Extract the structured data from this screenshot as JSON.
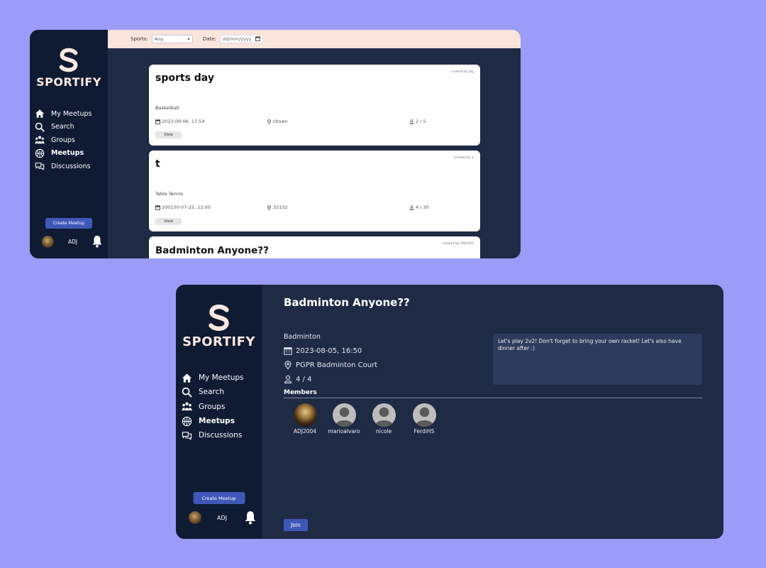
{
  "colors": {
    "background": "#9b9cf8",
    "sidebar": "#0e1b33",
    "main": "#1f2a45",
    "filter_bar": "#fbe4dc",
    "accent": "#3f58b8",
    "logo": "#fce8e1"
  },
  "app": {
    "name": "SPORTIFY"
  },
  "sidebar": {
    "items": [
      {
        "label": "My Meetups",
        "icon": "home-icon"
      },
      {
        "label": "Search",
        "icon": "search-icon"
      },
      {
        "label": "Groups",
        "icon": "groups-icon"
      },
      {
        "label": "Meetups",
        "icon": "meetups-icon",
        "active": true
      },
      {
        "label": "Discussions",
        "icon": "discussions-icon"
      }
    ],
    "create_button": "Create Meetup",
    "user_name": "ADJ"
  },
  "filters": {
    "sports_label": "Sports:",
    "sports_value": "Any",
    "date_label": "Date:",
    "date_placeholder": "dd/mm/yyyy"
  },
  "meetups": [
    {
      "title": "sports day",
      "creator": "created by Sig",
      "sport": "Basketball",
      "datetime": "2023-09-06, 17:54",
      "location": "Utown",
      "capacity": "2 / 5",
      "button": "View"
    },
    {
      "title": "t",
      "creator": "created by a",
      "sport": "Table Tennis",
      "datetime": "200130-07-25, 12:00",
      "location": "32132",
      "capacity": "4 / 30",
      "button": "View"
    },
    {
      "title": "Badminton Anyone??",
      "creator": "created by ADJ2004"
    }
  ],
  "detail": {
    "title": "Badminton Anyone??",
    "sport": "Badminton",
    "datetime": "2023-08-05, 16:50",
    "location": "PGPR Badminton Court",
    "capacity": "4 / 4",
    "description": "Let's play 2v2! Don't forget to bring your own racket! Let's also have dinner after :)",
    "members_label": "Members",
    "members": [
      "ADJ2004",
      "marioalvaro",
      "nicole",
      "FerdiHS"
    ],
    "join_button": "Join"
  }
}
